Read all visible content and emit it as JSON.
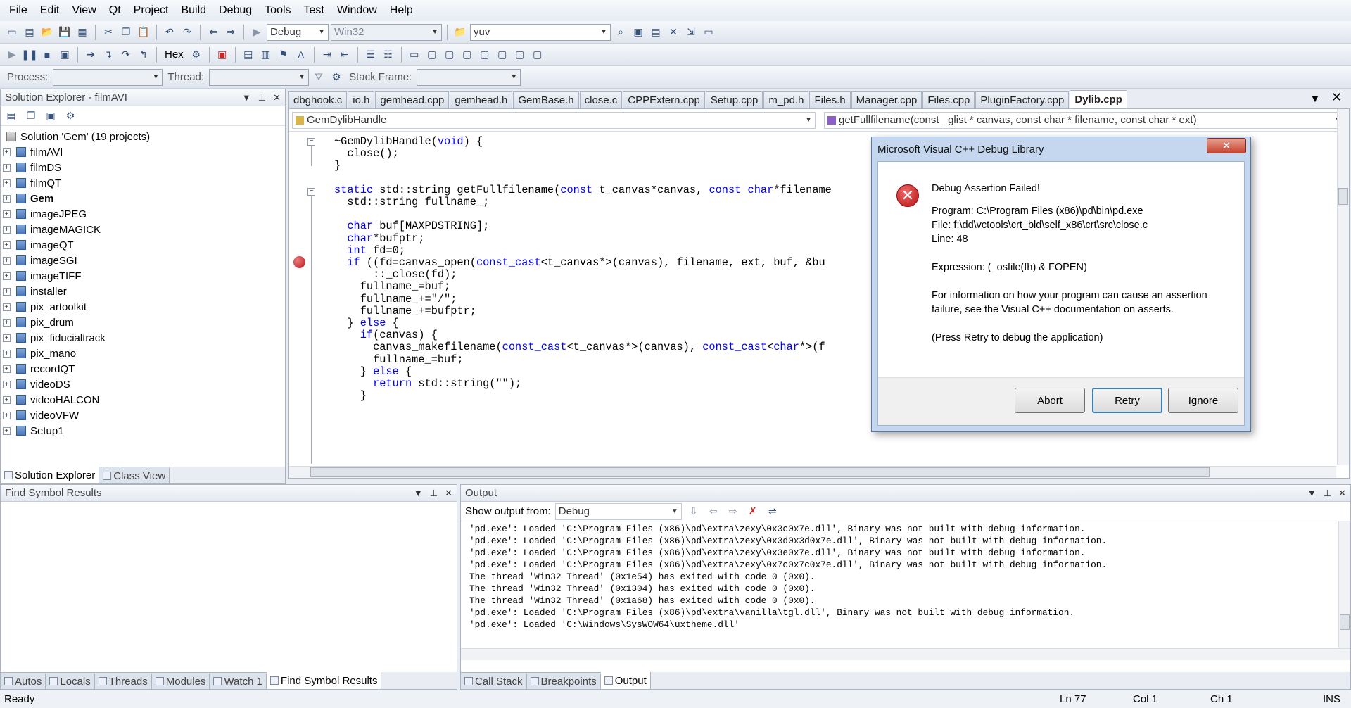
{
  "menu": [
    "File",
    "Edit",
    "View",
    "Qt",
    "Project",
    "Build",
    "Debug",
    "Tools",
    "Test",
    "Window",
    "Help"
  ],
  "toolbar": {
    "config": "Debug",
    "platform": "Win32",
    "find_value": "yuv",
    "hex_label": "Hex"
  },
  "debug_bar": {
    "process_label": "Process:",
    "thread_label": "Thread:",
    "stack_frame_label": "Stack Frame:"
  },
  "solution_explorer": {
    "title": "Solution Explorer - filmAVI",
    "root": "Solution 'Gem' (19 projects)",
    "projects": [
      "filmAVI",
      "filmDS",
      "filmQT",
      "Gem",
      "imageJPEG",
      "imageMAGICK",
      "imageQT",
      "imageSGI",
      "imageTIFF",
      "installer",
      "pix_artoolkit",
      "pix_drum",
      "pix_fiducialtrack",
      "pix_mano",
      "recordQT",
      "videoDS",
      "videoHALCON",
      "videoVFW",
      "Setup1"
    ],
    "bold_project": "Gem",
    "tabs": [
      "Solution Explorer",
      "Class View"
    ]
  },
  "doc_tabs": [
    "dbghook.c",
    "io.h",
    "gemhead.cpp",
    "gemhead.h",
    "GemBase.h",
    "close.c",
    "CPPExtern.cpp",
    "Setup.cpp",
    "m_pd.h",
    "Files.h",
    "Manager.cpp",
    "Files.cpp",
    "PluginFactory.cpp",
    "Dylib.cpp"
  ],
  "editor": {
    "scope": "GemDylibHandle",
    "member": "getFullfilename(const _glist * canvas, const char * filename, const char * ext)",
    "code": [
      "~GemDylibHandle(void) {",
      "  close();",
      "}",
      "",
      "static std::string getFullfilename(const t_canvas*canvas, const char*filename",
      "  std::string fullname_;",
      "",
      "  char buf[MAXPDSTRING];",
      "  char*bufptr;",
      "  int fd=0;",
      "  if ((fd=canvas_open(const_cast<t_canvas*>(canvas), filename, ext, buf, &bu",
      "      ::_close(fd);",
      "    fullname_=buf;",
      "    fullname_+=\"/\";",
      "    fullname_+=bufptr;",
      "  } else {",
      "    if(canvas) {",
      "      canvas_makefilename(const_cast<t_canvas*>(canvas), const_cast<char*>(f",
      "      fullname_=buf;",
      "    } else {",
      "      return std::string(\"\");",
      "    }"
    ]
  },
  "find_symbol": {
    "title": "Find Symbol Results"
  },
  "output": {
    "title": "Output",
    "show_from_label": "Show output from:",
    "show_from_value": "Debug",
    "lines": [
      "'pd.exe': Loaded 'C:\\Program Files (x86)\\pd\\extra\\zexy\\0x3c0x7e.dll', Binary was not built with debug information.",
      "'pd.exe': Loaded 'C:\\Program Files (x86)\\pd\\extra\\zexy\\0x3d0x3d0x7e.dll', Binary was not built with debug information.",
      "'pd.exe': Loaded 'C:\\Program Files (x86)\\pd\\extra\\zexy\\0x3e0x7e.dll', Binary was not built with debug information.",
      "'pd.exe': Loaded 'C:\\Program Files (x86)\\pd\\extra\\zexy\\0x7c0x7c0x7e.dll', Binary was not built with debug information.",
      "The thread 'Win32 Thread' (0x1e54) has exited with code 0 (0x0).",
      "The thread 'Win32 Thread' (0x1304) has exited with code 0 (0x0).",
      "The thread 'Win32 Thread' (0x1a68) has exited with code 0 (0x0).",
      "'pd.exe': Loaded 'C:\\Program Files (x86)\\pd\\extra\\vanilla\\tgl.dll', Binary was not built with debug information.",
      "'pd.exe': Loaded 'C:\\Windows\\SysWOW64\\uxtheme.dll'"
    ]
  },
  "bottom_left_tabs": [
    "Autos",
    "Locals",
    "Threads",
    "Modules",
    "Watch 1",
    "Find Symbol Results"
  ],
  "bottom_right_tabs": [
    "Call Stack",
    "Breakpoints",
    "Output"
  ],
  "dialog": {
    "title": "Microsoft Visual C++ Debug Library",
    "heading": "Debug Assertion Failed!",
    "program": "Program: C:\\Program Files (x86)\\pd\\bin\\pd.exe",
    "file": "File: f:\\dd\\vctools\\crt_bld\\self_x86\\crt\\src\\close.c",
    "line": "Line: 48",
    "expression": "Expression: (_osfile(fh) & FOPEN)",
    "info1": "For information on how your program can cause an assertion",
    "info2": "failure, see the Visual C++ documentation on asserts.",
    "hint": "(Press Retry to debug the application)",
    "abort": "Abort",
    "retry": "Retry",
    "ignore": "Ignore"
  },
  "status": {
    "ready": "Ready",
    "ln": "Ln 77",
    "col": "Col 1",
    "ch": "Ch 1",
    "ins": "INS"
  }
}
